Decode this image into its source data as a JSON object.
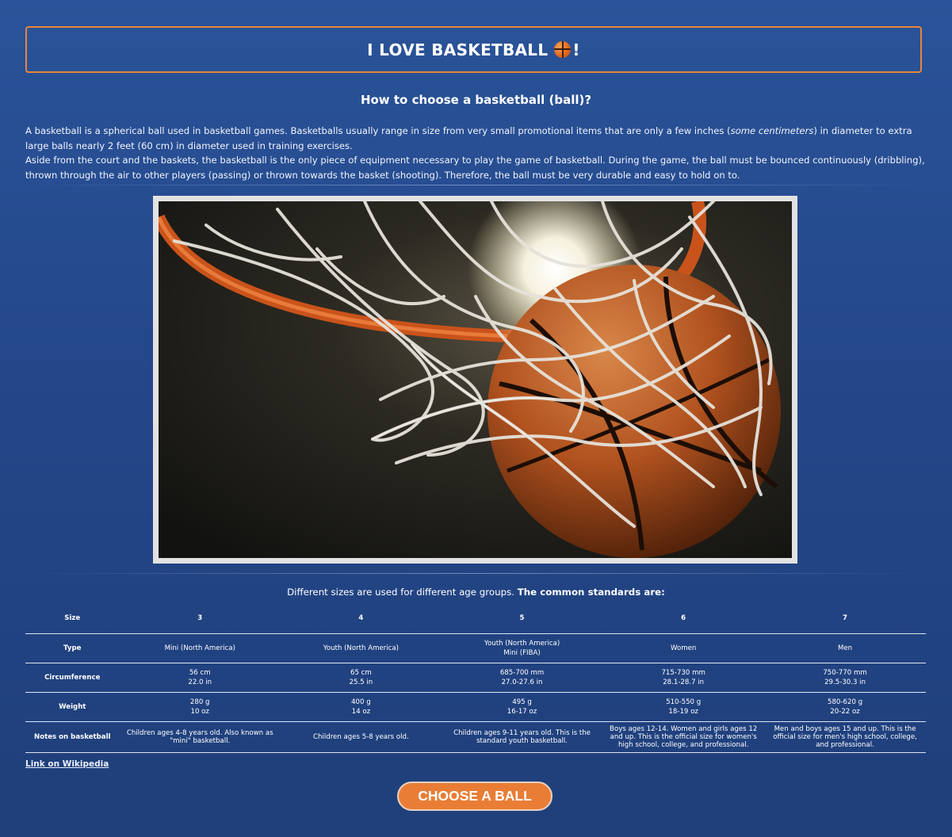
{
  "header": {
    "title": "I LOVE BASKETBALL",
    "title_suffix": "!",
    "title_icon": "basketball-icon"
  },
  "subtitle": "How to choose a basketball (ball)?",
  "intro": {
    "p1_before": "A basketball is a spherical ball used in basketball games. Basketballs usually range in size from very small promotional items that are only a few inches (",
    "p1_em": "some centimeters",
    "p1_after": ") in diameter to extra large balls nearly 2 feet (60 cm) in diameter used in training exercises.",
    "p2": "Aside from the court and the baskets, the basketball is the only piece of equipment necessary to play the game of basketball. During the game, the ball must be bounced continuously (dribbling), thrown through the air to other players (passing) or thrown towards the basket (shooting). Therefore, the ball must be very durable and easy to hold on to."
  },
  "sizes_caption": {
    "normal": "Different sizes are used for different age groups.",
    "bold": "The common standards are:"
  },
  "table": {
    "row_headers": [
      "Size",
      "Type",
      "Circumference",
      "Weight",
      "Notes on basketball"
    ],
    "sizes": [
      "3",
      "4",
      "5",
      "6",
      "7"
    ],
    "types": [
      [
        "Mini (North America)"
      ],
      [
        "Youth (North America)"
      ],
      [
        "Youth (North America)",
        "Mini (FIBA)"
      ],
      [
        "Women"
      ],
      [
        "Men"
      ]
    ],
    "circumference": [
      [
        "56 cm",
        "22.0 in"
      ],
      [
        "65 cm",
        "25.5 in"
      ],
      [
        "685-700 mm",
        "27.0-27.6 in"
      ],
      [
        "715-730 mm",
        "28.1-28.7 in"
      ],
      [
        "750-770 mm",
        "29.5-30.3 in"
      ]
    ],
    "weight": [
      [
        "280 g",
        "10 oz"
      ],
      [
        "400 g",
        "14 oz"
      ],
      [
        "495 g",
        "16-17 oz"
      ],
      [
        "510-550 g",
        "18-19 oz"
      ],
      [
        "580-620 g",
        "20-22 oz"
      ]
    ],
    "notes": [
      "Children ages 4-8 years old. Also known as \"mini\" basketball.",
      "Children ages 5-8 years old.",
      "Children ages 9-11 years old. This is the standard youth basketball.",
      "Boys ages 12-14. Women and girls ages 12 and up. This is the official size for women's high school, college, and professional.",
      "Men and boys ages 15 and up. This is the official size for men's high school, college, and professional."
    ]
  },
  "wiki_link": "Link on Wikipedia",
  "cta": "CHOOSE A BALL",
  "colors": {
    "accent": "#e8863d",
    "button": "#ea7d35",
    "background_top": "#2a5399",
    "background_bottom": "#1f3f7a"
  }
}
